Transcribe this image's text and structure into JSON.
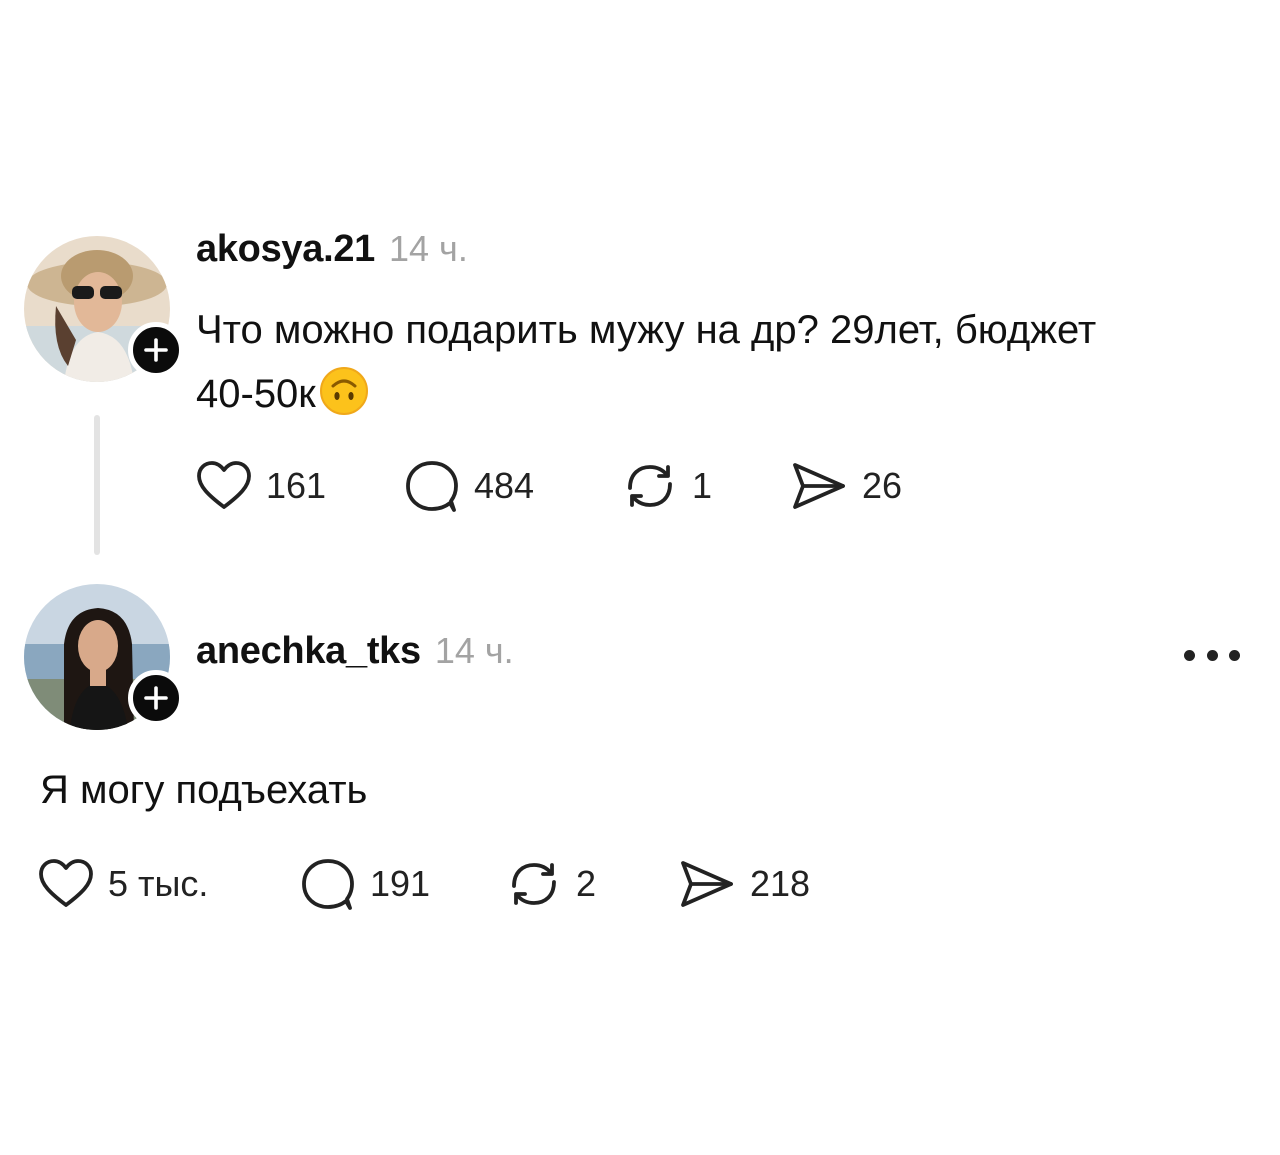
{
  "posts": [
    {
      "username": "akosya.21",
      "time": "14 ч.",
      "text": "Что можно подарить мужу на др? 29лет, бюджет",
      "text_line2": "40-50к",
      "emoji": "upside-down-face-emoji",
      "likes": "161",
      "comments": "484",
      "reposts": "1",
      "shares": "26"
    },
    {
      "username": "anechka_tks",
      "time": "14 ч.",
      "text": "Я могу подъехать",
      "likes": "5 тыс.",
      "comments": "191",
      "reposts": "2",
      "shares": "218"
    }
  ],
  "icons": {
    "like": "heart-icon",
    "comment": "comment-bubble-icon",
    "repost": "repost-arrows-icon",
    "share": "send-plane-icon",
    "follow": "plus-icon",
    "more": "more-dots-icon"
  },
  "colors": {
    "text": "#111111",
    "muted": "#a3a3a3",
    "badge": "#0b0b0b",
    "thread_line": "#e3e3e3"
  }
}
